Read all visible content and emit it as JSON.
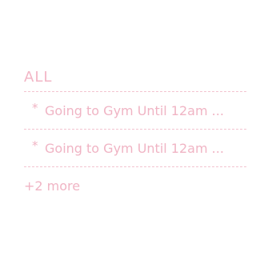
{
  "list": {
    "header": "ALL",
    "items": [
      {
        "bullet": "*",
        "text": "Going to Gym Until 12am ..."
      },
      {
        "bullet": "*",
        "text": "Going to Gym Until 12am ..."
      }
    ],
    "more_label": "+2 more"
  },
  "colors": {
    "accent": "#f0b4c4",
    "divider": "#f3c4d0",
    "background": "#ffffff"
  }
}
